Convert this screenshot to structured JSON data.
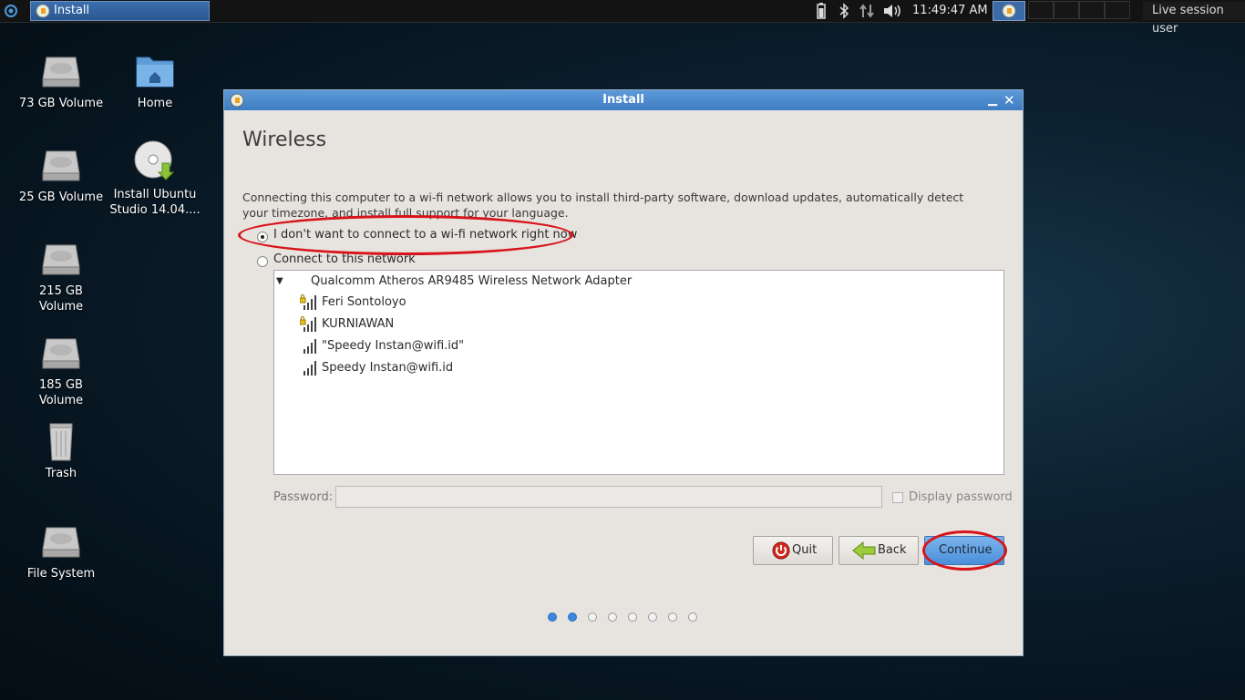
{
  "panel": {
    "task_title": "Install",
    "clock": "11:49:47 AM",
    "user": "Live session user",
    "icons": [
      "menu-icon",
      "battery-icon",
      "bluetooth-icon",
      "network-icon",
      "volume-icon"
    ]
  },
  "desktop": {
    "icons": [
      {
        "label": "73 GB Volume",
        "icon": "drive-icon"
      },
      {
        "label": "Home",
        "icon": "home-folder-icon"
      },
      {
        "label": "25 GB Volume",
        "icon": "drive-icon"
      },
      {
        "label": "Install Ubuntu Studio 14.04....",
        "icon": "install-disc-icon"
      },
      {
        "label": "215 GB Volume",
        "icon": "drive-icon"
      },
      {
        "label": "185 GB Volume",
        "icon": "drive-icon"
      },
      {
        "label": "Trash",
        "icon": "trash-icon"
      },
      {
        "label": "File System",
        "icon": "drive-icon"
      }
    ]
  },
  "window": {
    "title": "Install",
    "heading": "Wireless",
    "description": "Connecting this computer to a wi-fi network allows you to install third-party software, download updates, automatically detect your timezone, and install full support for your language.",
    "options": {
      "no_wifi": "I don't want to connect to a wi-fi network right now",
      "connect": "Connect to this network",
      "selected": "no_wifi"
    },
    "adapter": "Qualcomm Atheros AR9485 Wireless Network Adapter",
    "networks": [
      {
        "name": "Feri Sontoloyo",
        "secured": true
      },
      {
        "name": "KURNIAWAN",
        "secured": true
      },
      {
        "name": "\"Speedy Instan@wifi.id\"",
        "secured": false
      },
      {
        "name": "Speedy Instan@wifi.id",
        "secured": false
      }
    ],
    "password_label": "Password:",
    "password_value": "",
    "display_password_label": "Display password",
    "display_password_checked": false,
    "buttons": {
      "quit": "Quit",
      "back": "Back",
      "continue": "Continue"
    },
    "progress": {
      "total_steps": 8,
      "current_step": 2
    }
  },
  "colors": {
    "accent": "#3c86dc",
    "annotation": "#d8141b",
    "titlebar": "#4a88cc"
  }
}
